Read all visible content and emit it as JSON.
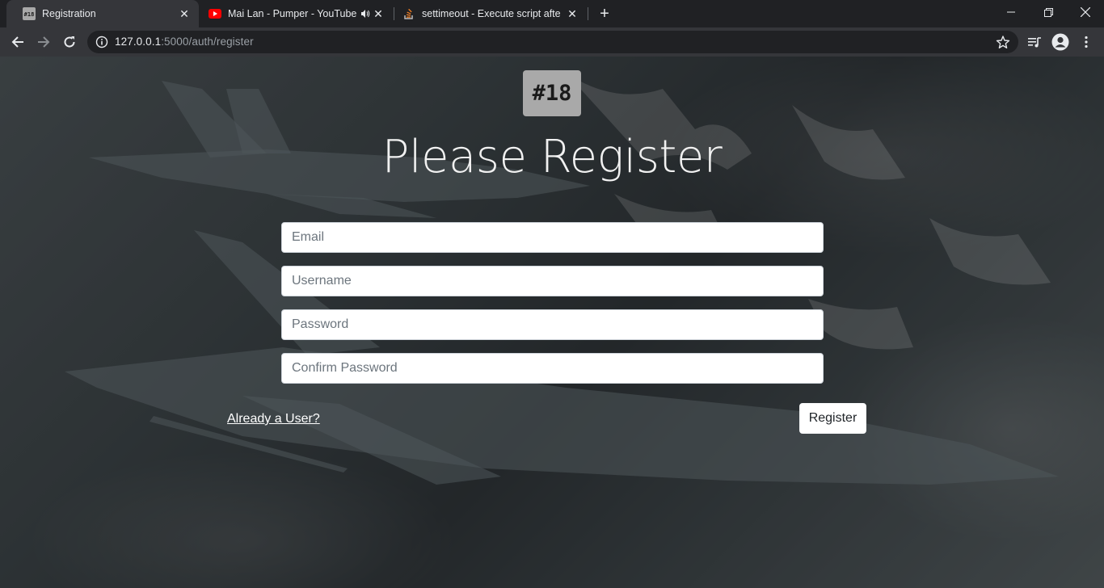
{
  "browser": {
    "tabs": [
      {
        "title": "Registration",
        "favicon": "#18",
        "active": true
      },
      {
        "title": "Mai Lan - Pumper - YouTube",
        "favicon": "youtube-icon",
        "audio": true
      },
      {
        "title": "settimeout - Execute script after s",
        "favicon": "stackoverflow-icon"
      }
    ],
    "url_host": "127.0.0.1",
    "url_rest": ":5000/auth/register"
  },
  "page": {
    "logo_text": "#18",
    "heading": "Please Register",
    "form": {
      "email_placeholder": "Email",
      "username_placeholder": "Username",
      "password_placeholder": "Password",
      "confirm_placeholder": "Confirm Password",
      "login_link": "Already a User?",
      "submit_label": "Register"
    }
  },
  "colors": {
    "tab_active": "#35363a",
    "tabstrip": "#202124",
    "logo_bg": "#a9a9a9"
  }
}
